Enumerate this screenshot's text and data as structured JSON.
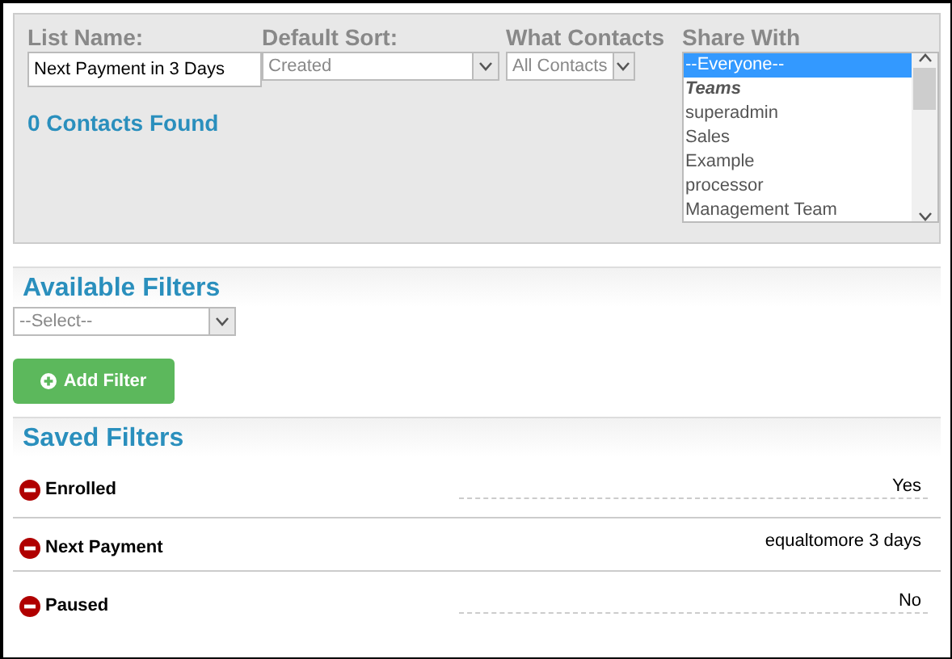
{
  "list_name": {
    "label": "List Name:",
    "value": "Next Payment in 3 Days"
  },
  "default_sort": {
    "label": "Default Sort:",
    "value": "Created"
  },
  "what_contacts": {
    "label": "What Contacts",
    "value": "All Contacts"
  },
  "share_with": {
    "label": "Share With",
    "options": [
      {
        "kind": "option",
        "label": "--Everyone--",
        "selected": true
      },
      {
        "kind": "group",
        "label": "Teams",
        "selected": false
      },
      {
        "kind": "option",
        "label": "superadmin",
        "selected": false
      },
      {
        "kind": "option",
        "label": "Sales",
        "selected": false
      },
      {
        "kind": "option",
        "label": "Example",
        "selected": false
      },
      {
        "kind": "option",
        "label": "processor",
        "selected": false
      },
      {
        "kind": "option",
        "label": "Management Team",
        "selected": false
      }
    ]
  },
  "contacts_found": "0 Contacts Found",
  "available_filters": {
    "title": "Available Filters",
    "select": "--Select--",
    "button": "Add Filter"
  },
  "saved_filters": {
    "title": "Saved Filters",
    "rows": [
      {
        "name": "Enrolled",
        "value": "Yes",
        "dashed": true
      },
      {
        "name": "Next Payment",
        "value": "equaltomore 3 days",
        "dashed": false
      },
      {
        "name": "Paused",
        "value": "No",
        "dashed": true
      }
    ]
  }
}
